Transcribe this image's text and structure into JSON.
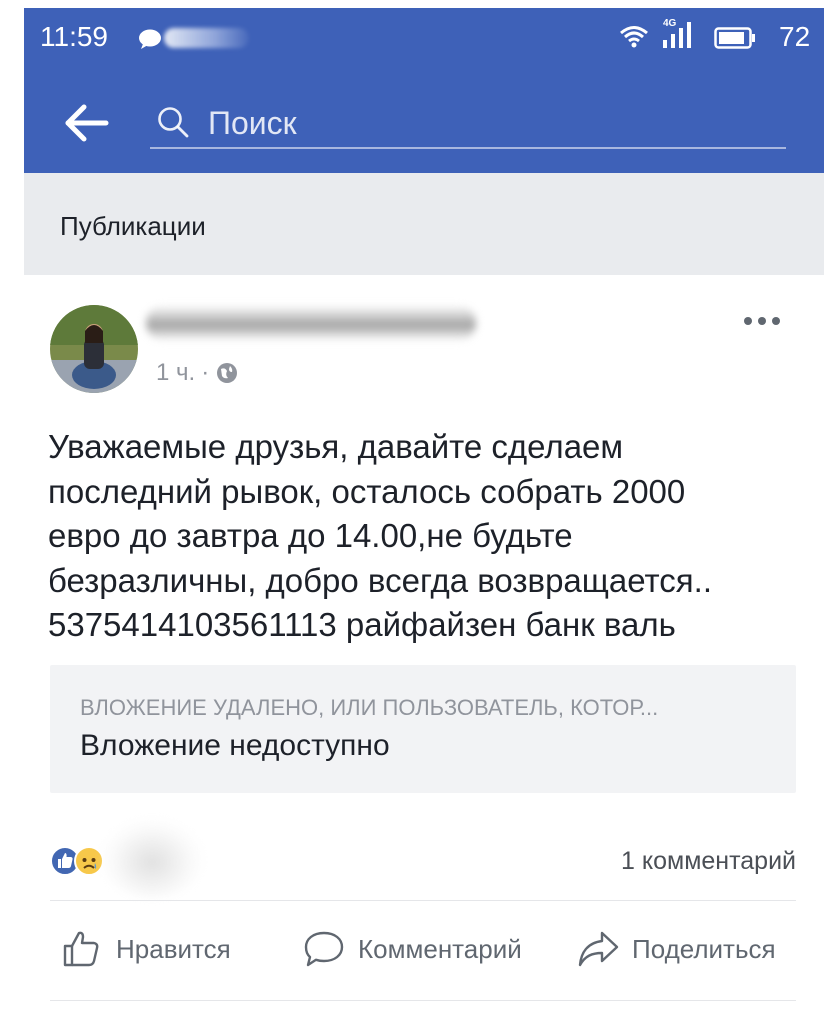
{
  "status_bar": {
    "time": "11:59",
    "network": "4G",
    "battery_level": "72"
  },
  "search": {
    "placeholder": "Поиск"
  },
  "section": {
    "title": "Публикации"
  },
  "post": {
    "time": "1 ч.",
    "text": "Уважаемые друзья, давайте сделаем\nпоследний рывок, осталось собрать 2000\nевро до завтра до 14.00,не будьте\nбезразличны, добро всегда возвращается..\n5375414103561113 райфайзен банк валь",
    "attachment": {
      "caption": "ВЛОЖЕНИЕ УДАЛЕНО, ИЛИ ПОЛЬЗОВАТЕЛЬ, КОТОР...",
      "title": "Вложение недоступно"
    },
    "comments_count": "1 комментарий",
    "actions": {
      "like": "Нравится",
      "comment": "Комментарий",
      "share": "Поделиться"
    }
  },
  "colors": {
    "brand": "#3e61b8",
    "section_bg": "#e9ebee",
    "like_blue": "#4267b2"
  }
}
